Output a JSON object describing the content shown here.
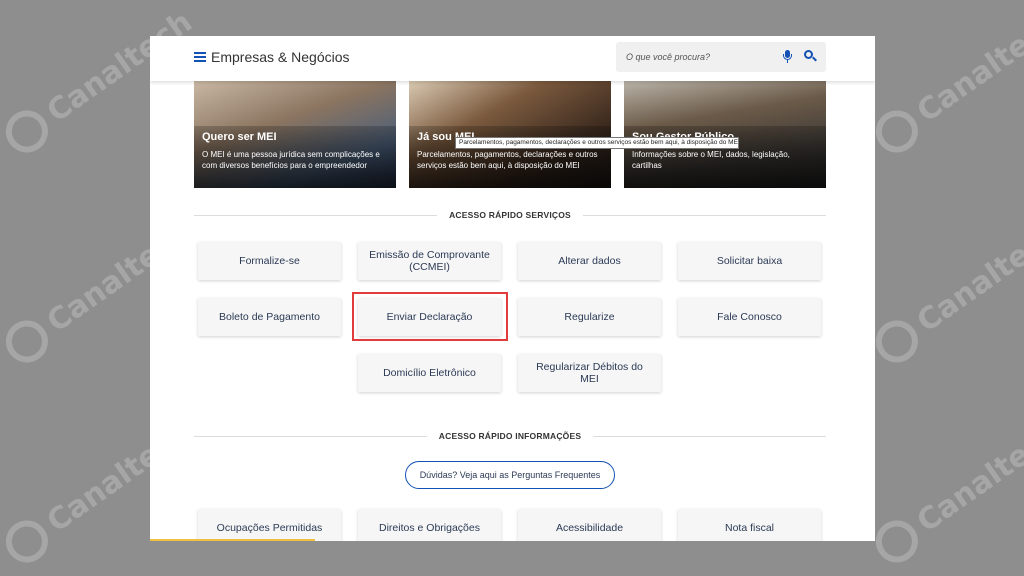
{
  "header": {
    "brand": "Empresas & Negócios",
    "search_placeholder": "O que você procura?"
  },
  "cards": [
    {
      "title": "Quero ser MEI",
      "description": "O MEI é uma pessoa jurídica sem complicações e com diversos benefícios para o empreendedor"
    },
    {
      "title": "Já sou MEI",
      "description": "Parcelamentos, pagamentos, declarações e outros serviços estão bem aqui, à disposição do MEI"
    },
    {
      "title": "Sou Gestor Público",
      "description": "Informações sobre o MEI, dados, legislação, cartilhas"
    }
  ],
  "tooltip": "Parcelamentos, pagamentos, declarações e outros serviços estão bem aqui, à disposição do MEI",
  "services_heading": "ACESSO RÁPIDO SERVIÇOS",
  "services": [
    "Formalize-se",
    "Emissão de Comprovante (CCMEI)",
    "Alterar dados",
    "Solicitar baixa",
    "Boleto de Pagamento",
    "Enviar Declaração",
    "Regularize",
    "Fale Conosco",
    "Domicílio Eletrônico",
    "Regularizar Débitos do MEI"
  ],
  "info_heading": "ACESSO RÁPIDO INFORMAÇÕES",
  "faq_label": "Dúvidas? Veja aqui as Perguntas Frequentes",
  "info_items": [
    "Ocupações Permitidas",
    "Direitos e Obrigações",
    "Acessibilidade",
    "Nota fiscal"
  ],
  "watermark": "Canaltech",
  "colors": {
    "accent": "#1351b4",
    "highlight": "#e23b3b",
    "background": "#8e8e8e"
  }
}
